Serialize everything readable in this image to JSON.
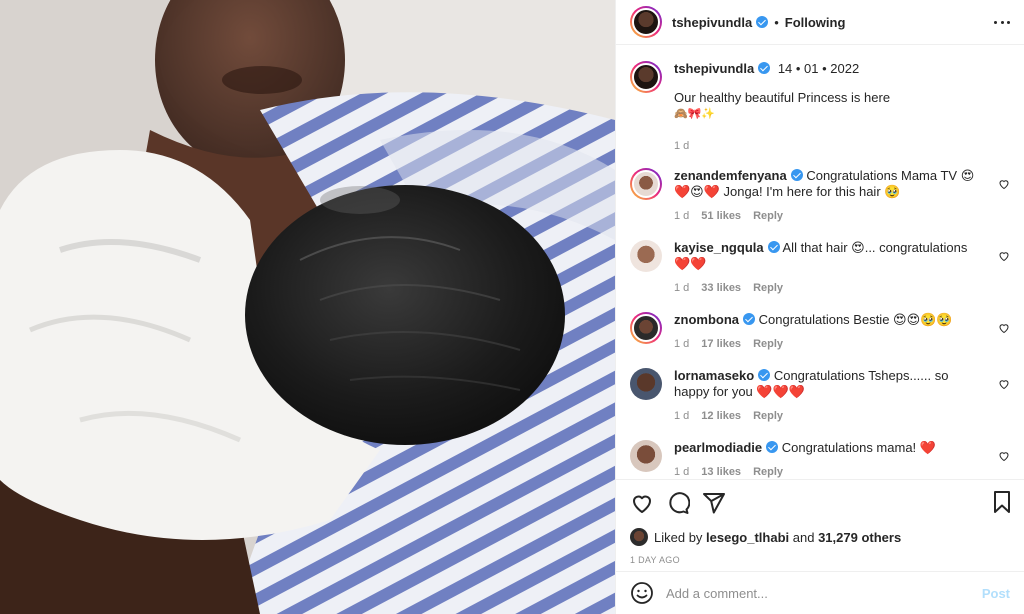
{
  "header": {
    "username": "tshepivundla",
    "separator": "•",
    "follow_label": "Following"
  },
  "caption": {
    "username": "tshepivundla",
    "date": "14 • 01 • 2022",
    "text": "Our healthy beautiful Princess is here",
    "emoji": "🙈🎀✨",
    "age": "1 d"
  },
  "comments": [
    {
      "username": "zenandemfenyana",
      "text": "Congratulations Mama TV 😍❤️😍❤️ Jonga! I'm here for this hair 🥹",
      "age": "1 d",
      "likes": "51 likes",
      "reply": "Reply"
    },
    {
      "username": "kayise_ngqula",
      "text": "All that hair 😍... congratulations ❤️❤️",
      "age": "1 d",
      "likes": "33 likes",
      "reply": "Reply"
    },
    {
      "username": "znombona",
      "text": "Congratulations Bestie 😍😍🥹🥹",
      "age": "1 d",
      "likes": "17 likes",
      "reply": "Reply"
    },
    {
      "username": "lornamaseko",
      "text": "Congratulations Tsheps...... so happy for you ❤️❤️❤️",
      "age": "1 d",
      "likes": "12 likes",
      "reply": "Reply"
    },
    {
      "username": "pearlmodiadie",
      "text": "Congratulations mama! ❤️",
      "age": "1 d",
      "likes": "13 likes",
      "reply": "Reply"
    }
  ],
  "likes": {
    "prefix": "Liked by",
    "user": "lesego_tlhabi",
    "middle": "and",
    "others": "31,279 others"
  },
  "time_ago": "1 DAY AGO",
  "add_comment": {
    "placeholder": "Add a comment...",
    "post_label": "Post"
  },
  "icons": [
    "heart-icon",
    "comment-icon",
    "share-icon",
    "bookmark-icon",
    "more-icon",
    "emoji-icon",
    "verified-icon"
  ],
  "colors": {
    "verified": "#3897f0",
    "post_disabled": "#b2dffc",
    "muted": "#8e8e8e",
    "stripe": "#6f7fc0"
  }
}
